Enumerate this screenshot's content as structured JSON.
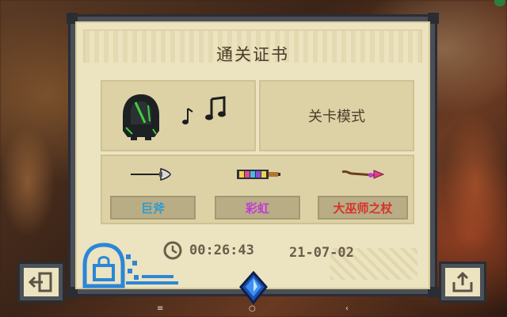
{
  "certificate": {
    "title": "通关证书",
    "mode": "关卡模式",
    "character_icon": "hooded-assassin-icon",
    "music_icon": "music-notes-icon",
    "weapons": [
      {
        "name": "巨斧",
        "icon": "great-axe-icon",
        "color": "#2f9bd1"
      },
      {
        "name": "彩虹",
        "icon": "rainbow-gun-icon",
        "color": "#c23ad8"
      },
      {
        "name": "大巫师之杖",
        "icon": "archmage-staff-icon",
        "color": "#d8322c"
      }
    ],
    "clear_time": "00:26:43",
    "date": "21-07-02",
    "stamp_icon": "blue-seal-stamp-icon"
  },
  "buttons": {
    "exit_icon": "exit-door-icon",
    "share_icon": "share-upload-icon"
  },
  "center_gem_icon": "blue-gem-icon",
  "navbar": {
    "menu_glyph": "≡",
    "home_glyph": "○",
    "back_glyph": "‹"
  }
}
